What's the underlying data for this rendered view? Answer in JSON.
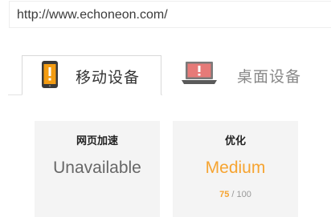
{
  "url_bar": {
    "value": "http://www.echoneon.com/"
  },
  "tabs": [
    {
      "label": "移动设备",
      "icon": "mobile-phone-icon",
      "active": true
    },
    {
      "label": "桌面设备",
      "icon": "laptop-icon",
      "active": false
    }
  ],
  "cards": [
    {
      "title": "网页加速",
      "value": "Unavailable"
    },
    {
      "title": "优化",
      "value": "Medium",
      "score": "75",
      "score_sep": " / ",
      "score_max": "100"
    }
  ],
  "colors": {
    "accent_orange": "#f6a431",
    "phone_orange": "#f39c12",
    "laptop_red": "#e67a78",
    "card_bg": "#f4f4f4"
  }
}
